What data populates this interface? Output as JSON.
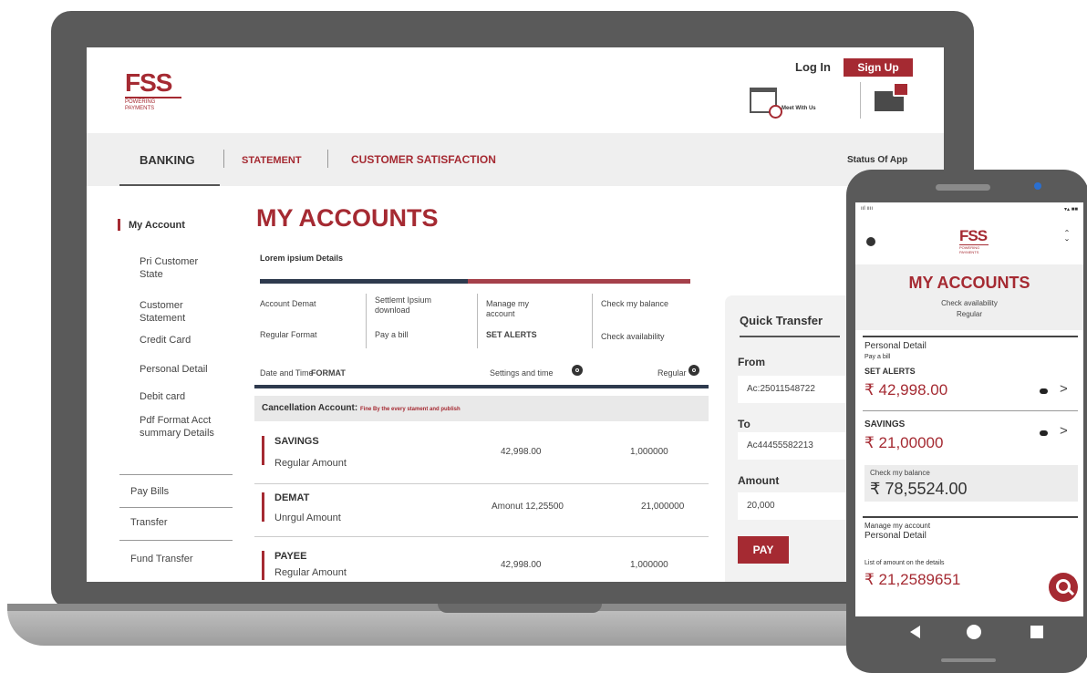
{
  "header": {
    "logo_main": "FSS",
    "logo_sub": "POWERING PAYMENTS",
    "login": "Log In",
    "signup": "Sign Up",
    "meet_label": "Meet With Us"
  },
  "topnav": {
    "banking": "BANKING",
    "statement": "STATEMENT",
    "customer_satisfaction": "CUSTOMER SATISFACTION",
    "status": "Status Of App"
  },
  "sidebar": {
    "my_account": "My Account",
    "pri_customer": "Pri Customer State",
    "customer_statement": "Customer Statement",
    "credit_card": "Credit Card",
    "personal_detail": "Personal Detail",
    "debit_card": "Debit card",
    "pdf_format": "Pdf Format Acct summary Details",
    "pay_bills": "Pay Bills",
    "transfer": "Transfer",
    "fund_transfer": "Fund Transfer"
  },
  "main": {
    "title": "MY ACCOUNTS",
    "lorem": "Lorem ipsium Details",
    "grid": {
      "account_demat": "Account Demat",
      "regular_format": "Regular Format",
      "settlement": "Settlemt Ipsium download",
      "pay_bill": "Pay a bill",
      "manage": "Manage my account",
      "set_alerts": "SET ALERTS",
      "check_balance": "Check my balance",
      "check_availability": "Check availability"
    },
    "table_header": {
      "date_time": "Date and Time",
      "format": "FORMAT",
      "settings": "Settings and time",
      "regular": "Regular"
    },
    "cancellation": {
      "label": "Cancellation Account:",
      "note": "Fine By the every stament and publish"
    },
    "rows": [
      {
        "name": "SAVINGS",
        "sub": "Regular Amount",
        "amount": "42,998.00",
        "value": "1,000000"
      },
      {
        "name": "DEMAT",
        "sub": "Unrgul Amount",
        "amount": "Amonut 12,25500",
        "value": "21,000000"
      },
      {
        "name": "PAYEE",
        "sub": "Regular Amount",
        "amount": "42,998.00",
        "value": "1,000000"
      }
    ]
  },
  "quick_transfer": {
    "title": "Quick Transfer",
    "from_label": "From",
    "from_value": "Ac:25011548722",
    "to_label": "To",
    "to_value": "Ac44455582213",
    "amount_label": "Amount",
    "amount_value": "20,000",
    "pay_button": "PAY"
  },
  "phone": {
    "status_left": "ııl ıııı",
    "status_right": "▾▴ ■■",
    "logo": "FSS",
    "logo_sub": "POWERING PAYMENTS",
    "title": "MY ACCOUNTS",
    "check_availability": "Check availability",
    "regular": "Regular",
    "personal_detail": "Personal Detail",
    "pay_bill": "Pay a bill",
    "set_alerts": "SET ALERTS",
    "set_alerts_amount": "₹ 42,998.00",
    "savings": "SAVINGS",
    "savings_amount": "₹ 21,00000",
    "check_balance": "Check my balance",
    "balance_amount": "₹ 78,5524.00",
    "manage": "Manage my account",
    "personal_detail2": "Personal Detail",
    "list_label": "List of amount on the details",
    "list_amount": "₹ 21,2589651"
  }
}
